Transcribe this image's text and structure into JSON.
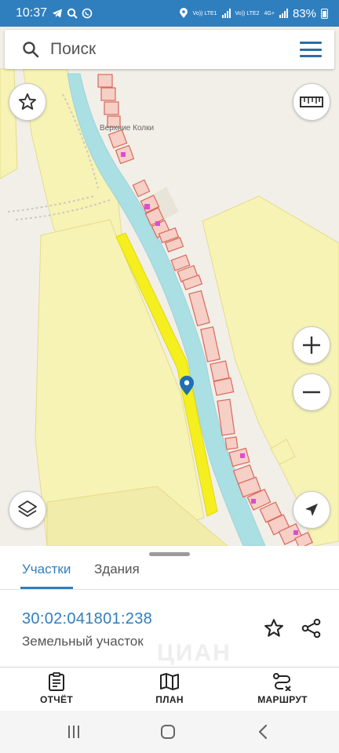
{
  "status_bar": {
    "time": "10:37",
    "net1": "Vo)) LTE1",
    "net2": "Vo)) LTE2",
    "net3": "4G+",
    "battery": "83%"
  },
  "search": {
    "placeholder": "Поиск"
  },
  "map": {
    "place_label": "Верхние Колки"
  },
  "panel": {
    "tabs": [
      {
        "label": "Участки",
        "active": true
      },
      {
        "label": "Здания",
        "active": false
      }
    ],
    "parcel": {
      "id": "30:02:041801:238",
      "type": "Земельный участок"
    },
    "watermark": "ЦИАН"
  },
  "actions": [
    {
      "label": "ОТЧЁТ",
      "icon": "clipboard-icon"
    },
    {
      "label": "ПЛАН",
      "icon": "map-icon"
    },
    {
      "label": "МАРШРУТ",
      "icon": "route-icon"
    }
  ],
  "colors": {
    "accent": "#2f7fbf",
    "river": "#aadfe4",
    "parcel_yellow": "#f7f3b5",
    "highlight": "#f5ef1f",
    "building": "#f6cfc6"
  }
}
